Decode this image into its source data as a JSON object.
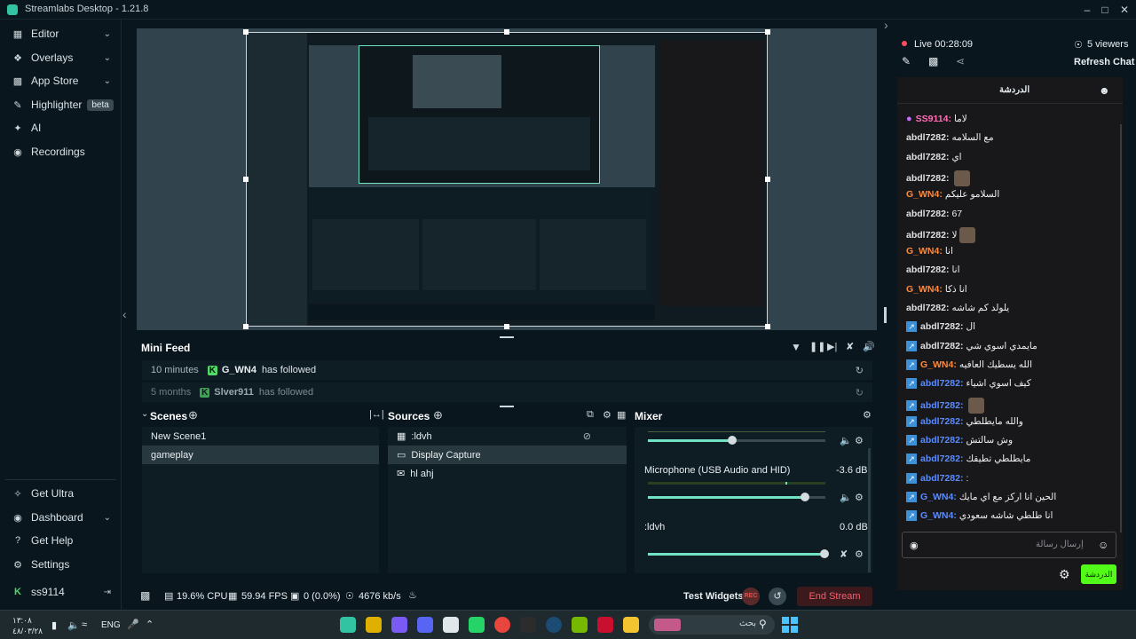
{
  "window": {
    "title": "Streamlabs Desktop - 1.21.8"
  },
  "sidebar": {
    "items": [
      {
        "label": "Editor",
        "icon": "editor-icon"
      },
      {
        "label": "Overlays",
        "icon": "overlays-icon"
      },
      {
        "label": "App Store",
        "icon": "app-store-icon"
      },
      {
        "label": "Highlighter",
        "icon": "highlighter-icon",
        "badge": "beta"
      },
      {
        "label": "AI",
        "icon": "ai-icon"
      },
      {
        "label": "Recordings",
        "icon": "recordings-icon"
      }
    ],
    "bottom": [
      {
        "label": "Get Ultra",
        "icon": "ultra-icon"
      },
      {
        "label": "Dashboard",
        "icon": "dashboard-icon"
      },
      {
        "label": "Get Help",
        "icon": "help-icon"
      },
      {
        "label": "Settings",
        "icon": "gear-icon"
      }
    ],
    "user": "ss9114"
  },
  "minifeed": {
    "title": "Mini Feed",
    "rows": [
      {
        "time": "10 minutes",
        "user": "G_WN4",
        "action": "has followed"
      },
      {
        "time": "5 months",
        "user": "Slver911",
        "action": "has followed"
      }
    ]
  },
  "scenes": {
    "title": "Scenes",
    "items": [
      "New Scene1",
      "gameplay"
    ],
    "selected": 1
  },
  "sources": {
    "title": "Sources",
    "items": [
      ":ldvh",
      "Display Capture",
      "hl ahj"
    ],
    "selected": 1
  },
  "mixer": {
    "title": "Mixer",
    "channels": [
      {
        "name": "",
        "db": "",
        "level": 0.48
      },
      {
        "name": "Microphone (USB Audio and HID)",
        "db": "-3.6 dB",
        "level": 0.88
      },
      {
        "name": ":ldvh",
        "db": "0.0 dB",
        "level": 1.0
      }
    ]
  },
  "status": {
    "cpu": "19.6% CPU",
    "fps": "59.94 FPS",
    "dropped": "0 (0.0%)",
    "bitrate": "4676 kb/s",
    "test_widgets": "Test Widgets",
    "rec": "REC",
    "end_stream": "End Stream"
  },
  "chat": {
    "live": "Live 00:28:09",
    "viewers": "5 viewers",
    "refresh": "Refresh Chat",
    "header": "الدردشة",
    "placeholder": "إرسال رسالة",
    "send": "الدردشة",
    "messages": [
      {
        "user": "SS9114",
        "text": "لاما",
        "color": "#ff6eb4",
        "icon": "mic"
      },
      {
        "user": "abdl7282",
        "text": "مع السلامه",
        "color": "#e0e0e0"
      },
      {
        "user": "abdl7282",
        "text": "اي",
        "color": "#e0e0e0"
      },
      {
        "user": "abdl7282",
        "text": "",
        "color": "#e0e0e0",
        "emote": true
      },
      {
        "user": "G_WN4",
        "text": "السلامو عليكم",
        "color": "#ff8a3d"
      },
      {
        "user": "abdl7282",
        "text": "67",
        "color": "#e0e0e0"
      },
      {
        "user": "abdl7282",
        "text": "لا",
        "color": "#e0e0e0",
        "emote": true
      },
      {
        "user": "G_WN4",
        "text": "انا",
        "color": "#ff8a3d"
      },
      {
        "user": "abdl7282",
        "text": "انا",
        "color": "#e0e0e0"
      },
      {
        "user": "G_WN4",
        "text": "انا ذكا",
        "color": "#ff8a3d"
      },
      {
        "user": "abdl7282",
        "text": "يلولد كم شاشه",
        "color": "#e0e0e0"
      },
      {
        "user": "abdl7282",
        "text": "ال",
        "color": "#e0e0e0",
        "icon": "bolt"
      },
      {
        "user": "abdl7282",
        "text": "مايمدي اسوي شي",
        "color": "#e0e0e0",
        "icon": "bolt"
      },
      {
        "user": "G_WN4",
        "text": "الله يسطيك العافيه",
        "color": "#ff8a3d",
        "icon": "bolt"
      },
      {
        "user": "abdl7282",
        "text": "كيف اسوي اشياء",
        "color": "#5b8cff",
        "icon": "bolt"
      },
      {
        "user": "abdl7282",
        "text": "",
        "color": "#5b8cff",
        "icon": "bolt",
        "emote": true
      },
      {
        "user": "abdl7282",
        "text": "والله مايطلطي",
        "color": "#5b8cff",
        "icon": "bolt"
      },
      {
        "user": "abdl7282",
        "text": "وش سالتش",
        "color": "#5b8cff",
        "icon": "bolt"
      },
      {
        "user": "abdl7282",
        "text": "مايطلطي تطيقك",
        "color": "#5b8cff",
        "icon": "bolt"
      },
      {
        "user": "abdl7282",
        "text": ":",
        "color": "#5b8cff",
        "icon": "bolt"
      },
      {
        "user": "G_WN4",
        "text": "الحين انا اركز مع اي مايك",
        "color": "#5b8cff",
        "icon": "bolt"
      },
      {
        "user": "G_WN4",
        "text": "انا طلطي شاشه سعودي",
        "color": "#5b8cff",
        "icon": "bolt"
      }
    ]
  },
  "taskbar": {
    "lang": "ENG",
    "time": "١٣:٠٨",
    "date": "٤٨/٠٣/٢٨",
    "search": "بحث"
  }
}
